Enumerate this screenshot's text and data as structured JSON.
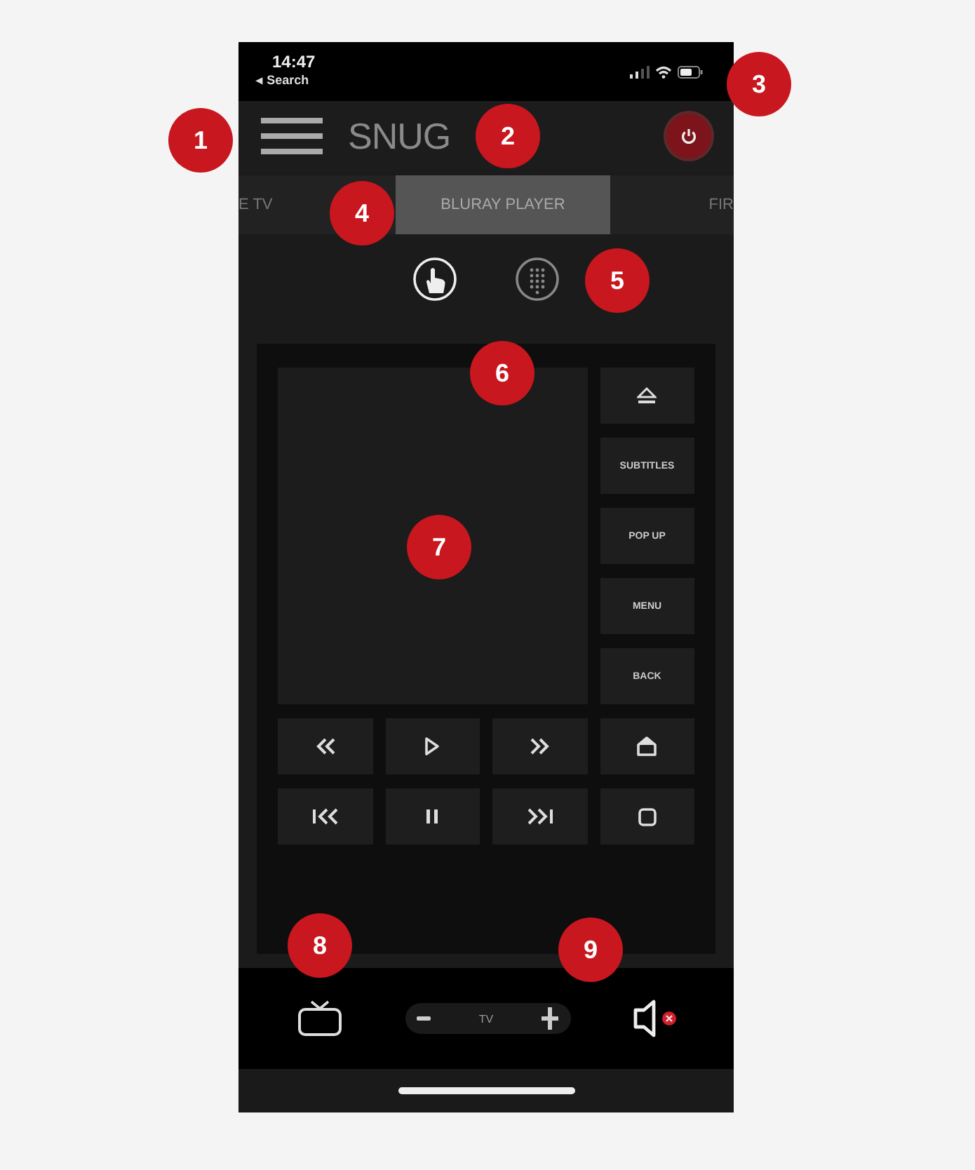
{
  "status_bar": {
    "time": "14:47",
    "back_link": "◂ Search"
  },
  "header": {
    "title": "SNUG"
  },
  "tabs": [
    {
      "label": "E TV",
      "selected": false
    },
    {
      "label": "BLURAY PLAYER",
      "selected": true
    },
    {
      "label": "FIR",
      "selected": false
    }
  ],
  "modes": [
    {
      "kind": "touch",
      "selected": true
    },
    {
      "kind": "keypad",
      "selected": false
    }
  ],
  "side_buttons": [
    {
      "kind": "eject"
    },
    {
      "kind": "text",
      "label": "SUBTITLES"
    },
    {
      "kind": "text",
      "label": "POP UP"
    },
    {
      "kind": "text",
      "label": "MENU"
    },
    {
      "kind": "text",
      "label": "BACK"
    }
  ],
  "transport": [
    {
      "kind": "rewind"
    },
    {
      "kind": "play"
    },
    {
      "kind": "forward"
    },
    {
      "kind": "home"
    },
    {
      "kind": "previous"
    },
    {
      "kind": "pause"
    },
    {
      "kind": "next"
    },
    {
      "kind": "stop"
    }
  ],
  "bottom_bar": {
    "volume_label": "TV",
    "muted": true
  },
  "callouts": [
    {
      "label": "1"
    },
    {
      "label": "2"
    },
    {
      "label": "3"
    },
    {
      "label": "4"
    },
    {
      "label": "5"
    },
    {
      "label": "6"
    },
    {
      "label": "7"
    },
    {
      "label": "8"
    },
    {
      "label": "9"
    }
  ]
}
